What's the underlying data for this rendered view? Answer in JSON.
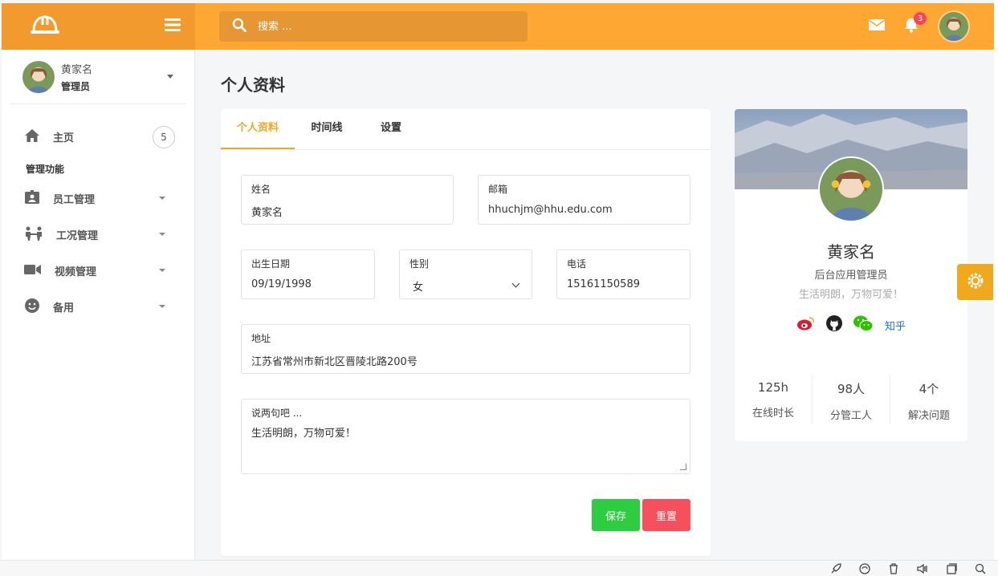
{
  "topbar": {
    "search_placeholder": "搜索 ...",
    "notification_count": "3"
  },
  "sidebar": {
    "user": {
      "name": "黄家名",
      "role": "管理员"
    },
    "home": {
      "label": "主页",
      "count": "5"
    },
    "section_title": "管理功能",
    "items": [
      {
        "label": "员工管理",
        "icon": "id-badge-icon"
      },
      {
        "label": "工况管理",
        "icon": "workers-icon"
      },
      {
        "label": "视频管理",
        "icon": "video-camera-icon"
      },
      {
        "label": "备用",
        "icon": "smile-icon"
      }
    ]
  },
  "page": {
    "title": "个人资料"
  },
  "tabs": [
    "个人资料",
    "时间线",
    "设置"
  ],
  "form": {
    "name": {
      "label": "姓名",
      "value": "黄家名"
    },
    "email": {
      "label": "邮箱",
      "value": "hhuchjm@hhu.edu.com"
    },
    "birthday": {
      "label": "出生日期",
      "value": "09/19/1998"
    },
    "gender": {
      "label": "性别",
      "value": "女"
    },
    "phone": {
      "label": "电话",
      "value": "15161150589"
    },
    "address": {
      "label": "地址",
      "value": "江苏省常州市新北区晋陵北路200号"
    },
    "bio": {
      "label": "说两句吧 ...",
      "value": "生活明朗，万物可爱！"
    },
    "save_label": "保存",
    "reset_label": "重置"
  },
  "profile": {
    "name": "黄家名",
    "role": "后台应用管理员",
    "motto": "生活明朗，万物可爱！",
    "zhihu_label": "知乎",
    "stats": [
      {
        "value": "125h",
        "label": "在线时长"
      },
      {
        "value": "98人",
        "label": "分管工人"
      },
      {
        "value": "4个",
        "label": "解决问题"
      }
    ]
  },
  "colors": {
    "topbar": "#ffa733",
    "accent": "#f2a623",
    "save": "#2ecc40",
    "reset": "#f5505c"
  }
}
